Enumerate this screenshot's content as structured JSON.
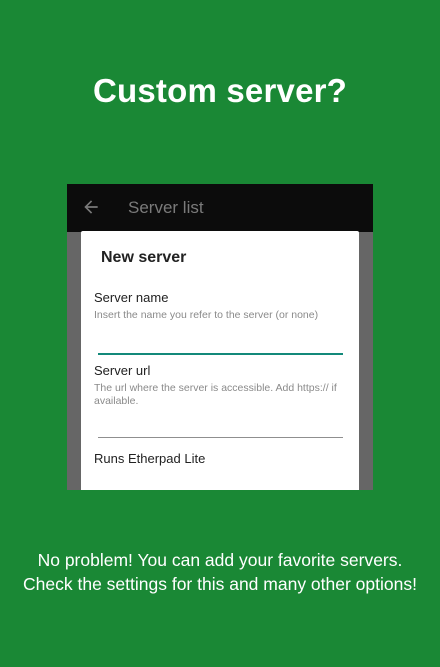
{
  "headline": "Custom server?",
  "appbar": {
    "title": "Server list",
    "back_icon": "arrow-back-icon"
  },
  "dialog": {
    "title": "New server",
    "fields": [
      {
        "label": "Server name",
        "hint": "Insert the name you refer to the server (or none)",
        "value": ""
      },
      {
        "label": "Server url",
        "hint": "The url where the server is accessible. Add https:// if available.",
        "value": ""
      }
    ],
    "toggle_label": "Runs Etherpad Lite"
  },
  "caption": "No problem! You can add your favorite servers. Check the settings for this and many other options!",
  "colors": {
    "background": "#1a8835",
    "accent": "#13897a",
    "appbar": "#0c0c0c"
  }
}
